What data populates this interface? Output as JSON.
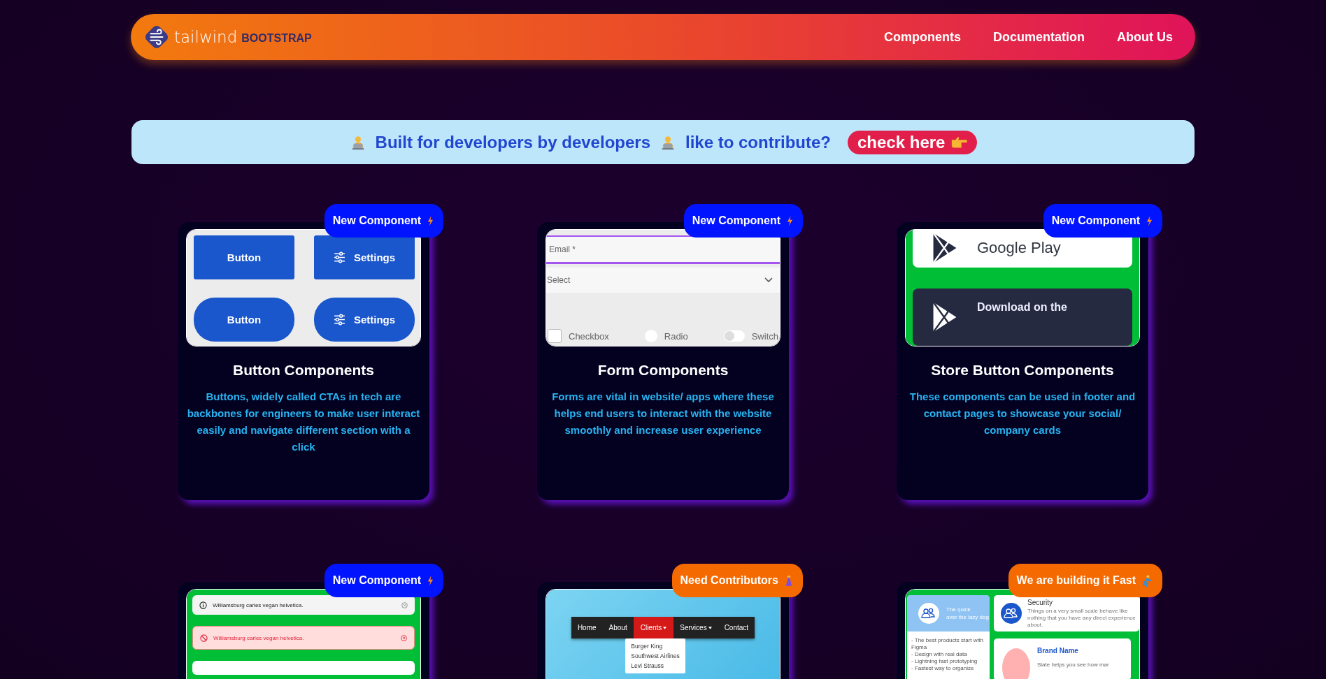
{
  "nav": {
    "brand_light": "tailwind",
    "brand_bold": "BOOTSTRAP",
    "links": [
      {
        "label": "Components"
      },
      {
        "label": "Documentation"
      },
      {
        "label": "About Us"
      }
    ]
  },
  "banner": {
    "text_1": "Built for developers by developers",
    "text_2": "like to contribute?",
    "cta": "check here"
  },
  "cards": [
    {
      "badge": {
        "label": "New Component",
        "kind": "new"
      },
      "title": "Button Components",
      "description": "Buttons, widely called CTAs in tech are backbones for engineers to make user interact easily and navigate different section with a click",
      "preview": {
        "kind": "buttons",
        "buttons": [
          {
            "label": "Button",
            "kind": "square",
            "icon": false
          },
          {
            "label": "Settings",
            "kind": "square",
            "icon": true
          },
          {
            "label": "Button",
            "kind": "pill",
            "icon": false
          },
          {
            "label": "Settings",
            "kind": "pill",
            "icon": true
          }
        ]
      }
    },
    {
      "badge": {
        "label": "New Component",
        "kind": "new"
      },
      "title": "Form Components",
      "description": "Forms are vital in website/ apps where these helps end users to interact with the website smoothly and increase user experience",
      "preview": {
        "kind": "form",
        "email_label": "Email *",
        "select_label": "Select",
        "options": [
          {
            "label": "Checkbox",
            "kind": "checkbox",
            "checked": false
          },
          {
            "label": "Radio",
            "kind": "radio",
            "checked": false
          },
          {
            "label": "Switch",
            "kind": "switch",
            "checked": false
          }
        ]
      }
    },
    {
      "badge": {
        "label": "New Component",
        "kind": "new"
      },
      "title": "Store Button Components",
      "description": "These components can be used in footer and contact pages to showcase your social/ company cards",
      "preview": {
        "kind": "store",
        "buttons": [
          {
            "label": "Google Play",
            "kind": "light"
          },
          {
            "label": "Download on the",
            "kind": "dark"
          }
        ]
      }
    },
    {
      "badge": {
        "label": "New Component",
        "kind": "new"
      },
      "preview": {
        "kind": "alerts",
        "alerts": [
          {
            "text": "Williamsburg carles vegan helvetica.",
            "kind": "info"
          },
          {
            "text": "Williamsburg carles vegan helvetica.",
            "kind": "danger"
          }
        ]
      }
    },
    {
      "badge": {
        "label": "Need Contributors",
        "kind": "contributors"
      },
      "preview": {
        "kind": "navbar",
        "items": [
          {
            "label": "Home",
            "selected": false,
            "dropdown": false
          },
          {
            "label": "About",
            "selected": false,
            "dropdown": false
          },
          {
            "label": "Clients",
            "selected": true,
            "dropdown": true
          },
          {
            "label": "Services",
            "selected": false,
            "dropdown": true
          },
          {
            "label": "Contact",
            "selected": false,
            "dropdown": false
          }
        ],
        "menu": [
          "Burger King",
          "Southwest Airlines",
          "Levi Strauss"
        ]
      }
    },
    {
      "badge": {
        "label": "We are building it Fast",
        "kind": "fast"
      },
      "preview": {
        "kind": "cards",
        "feature": {
          "title": "The quick",
          "subtitle": "over the lazy dog"
        },
        "list": [
          "-  The best products start with Figma",
          "- Design with real data",
          "- Lightning fast prototyping",
          "- Fastest way to organize"
        ],
        "security": {
          "title": "Security",
          "text": "Things on a very small scale behave like nothing that you have any direct experience about."
        },
        "brand": {
          "title": "Brand Name",
          "text": "Slate helps you see how mar"
        }
      }
    }
  ]
}
